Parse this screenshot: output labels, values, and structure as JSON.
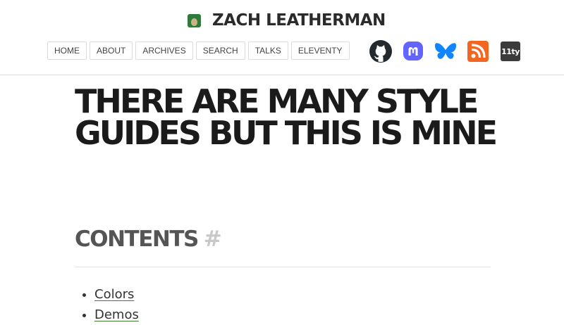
{
  "header": {
    "site_title": "ZACH LEATHERMAN",
    "nav": [
      {
        "label": "HOME"
      },
      {
        "label": "ABOUT"
      },
      {
        "label": "ARCHIVES"
      },
      {
        "label": "SEARCH"
      },
      {
        "label": "TALKS"
      },
      {
        "label": "ELEVENTY"
      }
    ],
    "social_icons": [
      "github-icon",
      "mastodon-icon",
      "bluesky-icon",
      "rss-icon",
      "eleventy-icon"
    ],
    "eleventy_icon_text": "11ty"
  },
  "main": {
    "title": "THERE ARE MANY STYLE GUIDES BUT THIS IS MINE",
    "contents_heading": "CONTENTS",
    "anchor_symbol": "#",
    "toc": [
      {
        "label": "Colors"
      },
      {
        "label": "Demos"
      }
    ]
  },
  "colors": {
    "text": "#1b1b1b",
    "accent": "#3f7c2f",
    "github": "#24292e",
    "mastodon": "#6364ff",
    "bluesky": "#1185fe",
    "rss": "#f26522"
  }
}
